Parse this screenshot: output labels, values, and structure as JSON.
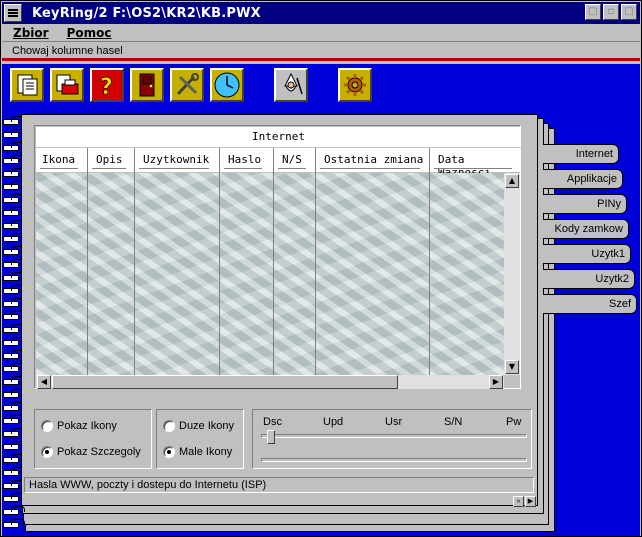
{
  "window": {
    "title": "KeyRing/2  F:\\OS2\\KR2\\KB.PWX"
  },
  "menu": [
    {
      "label": "Zbior"
    },
    {
      "label": "Pomoc"
    }
  ],
  "hint": "Chowaj kolumne hasel",
  "toolbar": {
    "buttons": [
      {
        "icon": "new-document-icon"
      },
      {
        "icon": "print-document-icon"
      },
      {
        "icon": "help-question-icon"
      },
      {
        "icon": "exit-door-icon"
      },
      {
        "icon": "tools-icon"
      },
      {
        "icon": "clock-icon"
      },
      {
        "icon": "wizard-icon"
      },
      {
        "icon": "gear-settings-icon"
      }
    ]
  },
  "table": {
    "title": "Internet",
    "columns": [
      "Ikona",
      "Opis",
      "Uzytkownik",
      "Haslo",
      "N/S",
      "Ostatnia zmiana",
      "Data Waznosci"
    ]
  },
  "view_options": {
    "pokaz_ikony": "Pokaz Ikony",
    "pokaz_szczegoly": "Pokaz Szczegoly",
    "selected_view": "Pokaz Szczegoly"
  },
  "icon_size": {
    "duze": "Duze Ikony",
    "male": "Male Ikony",
    "selected": "Male Ikony"
  },
  "slider": {
    "labels": [
      "Dsc",
      "Upd",
      "Usr",
      "S/N",
      "Pw"
    ]
  },
  "status": "Hasla WWW, poczty i dostepu do Internetu (ISP)",
  "tabs": [
    {
      "label": "Internet"
    },
    {
      "label": "Applikacje"
    },
    {
      "label": "PINy"
    },
    {
      "label": "Kody zamkow"
    },
    {
      "label": "Uzytk1"
    },
    {
      "label": "Uzytk2"
    },
    {
      "label": "Szef"
    }
  ],
  "colors": {
    "titlebar": "#000080",
    "toolbar_bg": "#0000d8",
    "accent_red": "#c00000"
  }
}
